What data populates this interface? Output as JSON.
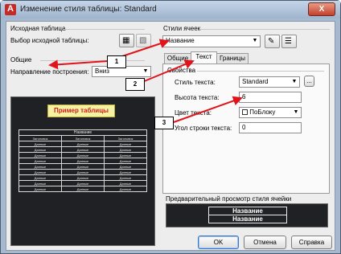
{
  "window": {
    "title": "Изменение стиля таблицы: Standard",
    "close_glyph": "X"
  },
  "source": {
    "group_label": "Исходная таблица",
    "select_label": "Выбор исходной таблицы:"
  },
  "general": {
    "group_label": "Общие",
    "direction_label": "Направление построения:",
    "direction_value": "Вниз"
  },
  "sample": {
    "title": "Пример таблицы",
    "header": "Название",
    "col_label": "Заголовок",
    "cell_label": "Данные",
    "col_count": 3,
    "row_count": 9
  },
  "cell_styles": {
    "group_label": "Стили ячеек",
    "style_value": "Название"
  },
  "tabs": [
    {
      "label": "Общие"
    },
    {
      "label": "Текст"
    },
    {
      "label": "Границы"
    }
  ],
  "props": {
    "group_label": "Свойства",
    "text_style_label": "Стиль текста:",
    "text_style_value": "Standard",
    "browse_label": "...",
    "text_height_label": "Высота текста:",
    "text_height_value": "6",
    "text_color_label": "Цвет текста:",
    "text_color_value": "ПоБлоку",
    "text_angle_label": "Угол строки текста:",
    "text_angle_value": "0"
  },
  "cell_preview": {
    "label": "Предварительный просмотр стиля ячейки",
    "line1": "Название",
    "line2": "Название"
  },
  "buttons": {
    "ok": "OK",
    "cancel": "Отмена",
    "help": "Справка"
  },
  "callouts": [
    "1",
    "2",
    "3"
  ],
  "colors": {
    "arrow": "#e0141b",
    "titlebar": "#a9bdd6",
    "dark_preview": "#1f2124"
  }
}
